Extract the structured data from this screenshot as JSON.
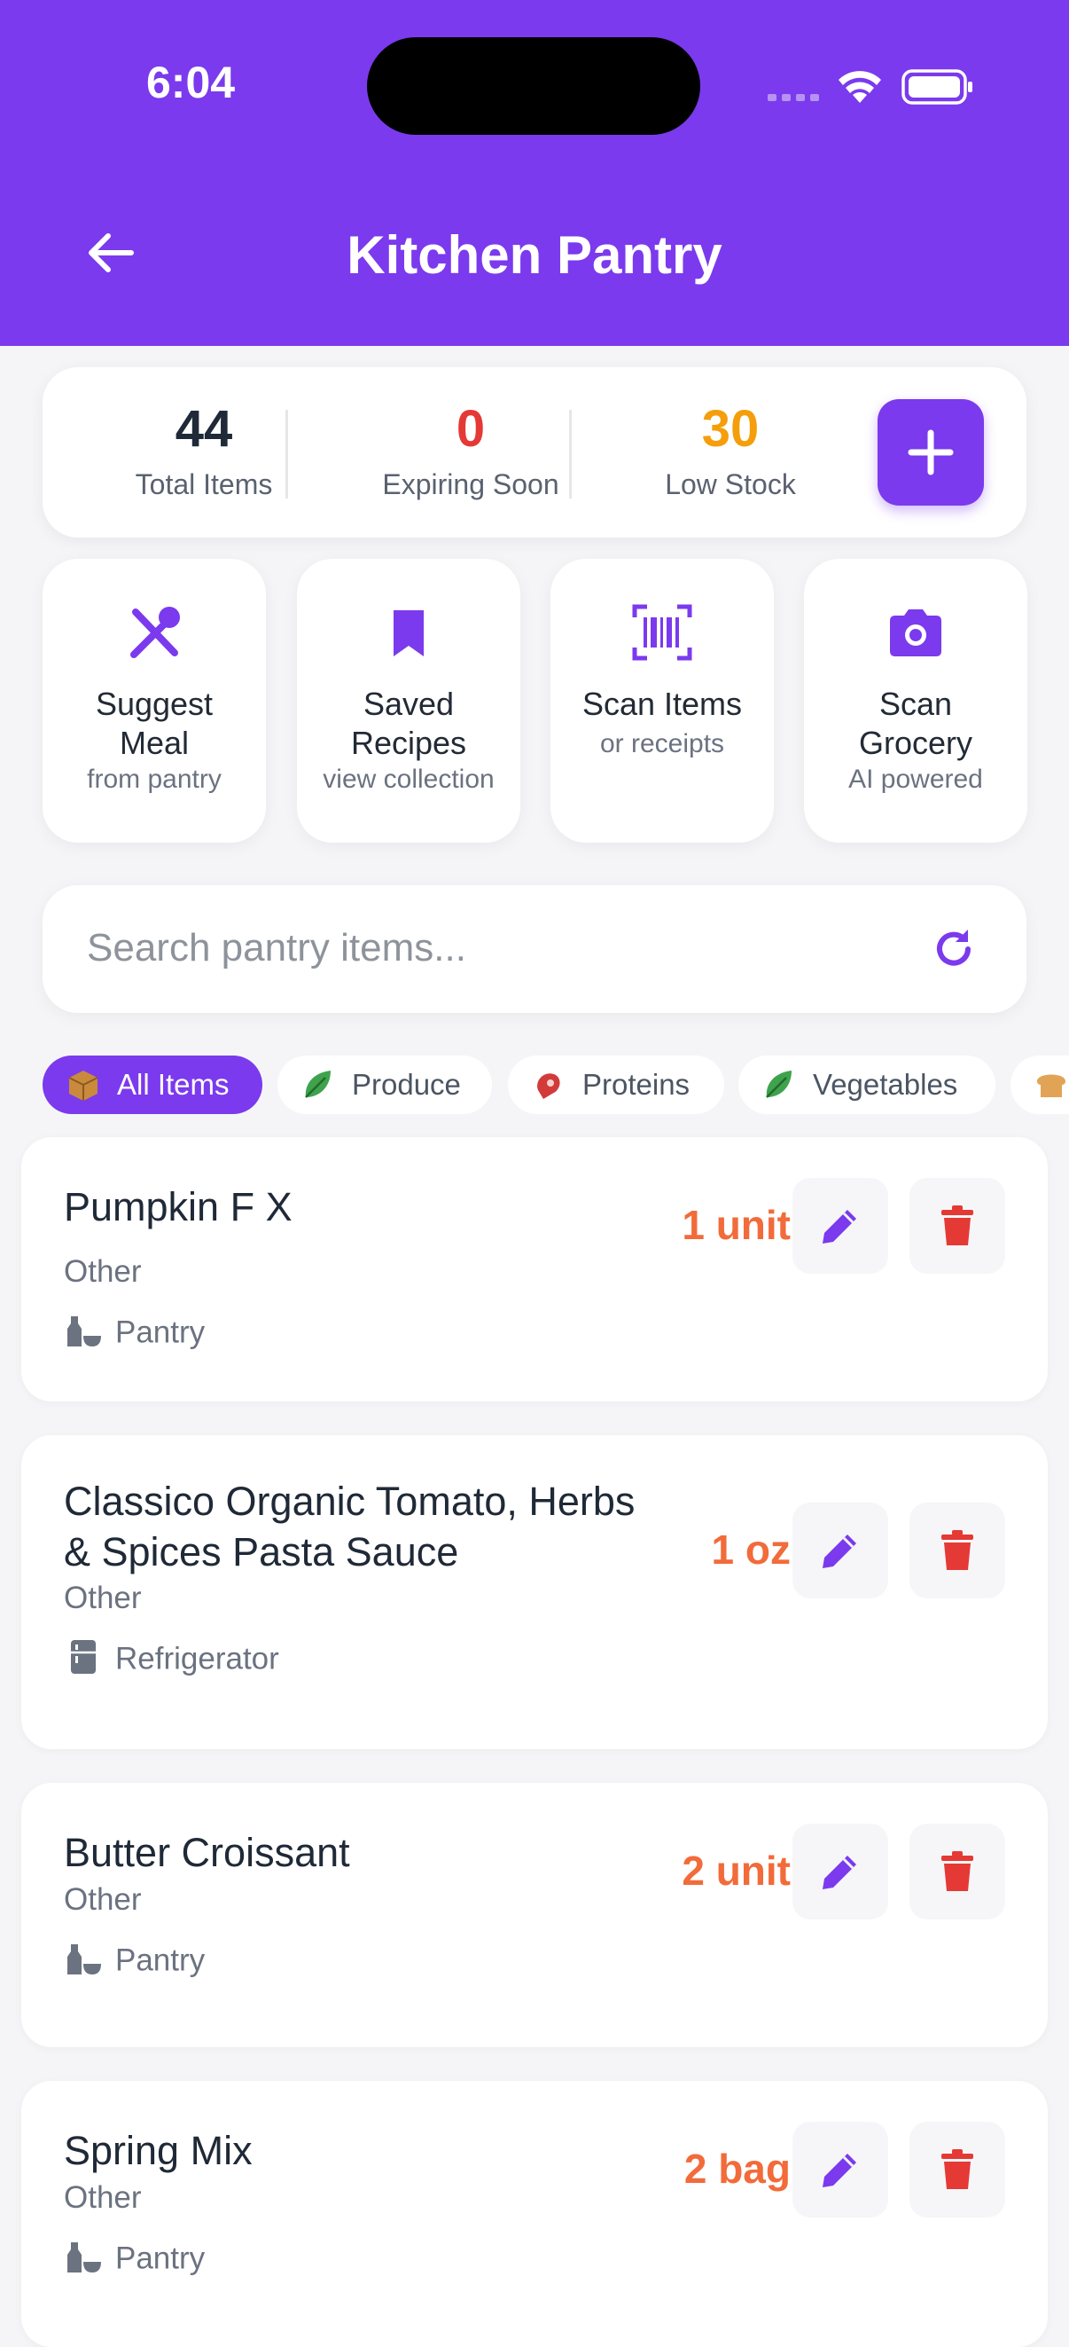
{
  "status_bar": {
    "time": "6:04"
  },
  "header": {
    "title": "Kitchen Pantry"
  },
  "stats": [
    {
      "value": "44",
      "label": "Total Items",
      "color": "#1f2937"
    },
    {
      "value": "0",
      "label": "Expiring Soon",
      "color": "#e53935"
    },
    {
      "value": "30",
      "label": "Low Stock",
      "color": "#f59e0b"
    }
  ],
  "actions": [
    {
      "title_line1": "Suggest",
      "title_line2": "Meal",
      "subtitle": "from pantry",
      "icon": "utensils-icon"
    },
    {
      "title_line1": "Saved",
      "title_line2": "Recipes",
      "subtitle": "view collection",
      "icon": "bookmark-icon"
    },
    {
      "title_line1": "Scan Items",
      "title_line2": "",
      "subtitle": "or receipts",
      "icon": "barcode-scan-icon"
    },
    {
      "title_line1": "Scan",
      "title_line2": "Grocery",
      "subtitle": "AI powered",
      "icon": "camera-icon"
    }
  ],
  "search": {
    "placeholder": "Search pantry items..."
  },
  "categories": [
    {
      "label": "All Items",
      "emoji": "box-icon",
      "active": true
    },
    {
      "label": "Produce",
      "emoji": "leafy-green-icon",
      "active": false
    },
    {
      "label": "Proteins",
      "emoji": "meat-icon",
      "active": false
    },
    {
      "label": "Vegetables",
      "emoji": "leafy-green-icon",
      "active": false
    },
    {
      "label": "",
      "emoji": "bread-icon",
      "active": false
    }
  ],
  "items": [
    {
      "name": "Pumpkin F X",
      "category": "Other",
      "location": "Pantry",
      "location_icon": "pantry-bottles-icon",
      "quantity": "1 unit"
    },
    {
      "name_line1": "Classico Organic Tomato, Herbs",
      "name_line2": "& Spices Pasta Sauce",
      "category": "Other",
      "location": "Refrigerator",
      "location_icon": "refrigerator-icon",
      "quantity": "1 oz"
    },
    {
      "name": "Butter Croissant",
      "category": "Other",
      "location": "Pantry",
      "location_icon": "pantry-bottles-icon",
      "quantity": "2 unit"
    },
    {
      "name": "Spring Mix",
      "category": "Other",
      "location": "Pantry",
      "location_icon": "pantry-bottles-icon",
      "quantity": "2 bag"
    }
  ],
  "colors": {
    "accent": "#7b3aed",
    "danger": "#e53935",
    "warning": "#f59e0b",
    "quantity": "#f26b3a"
  }
}
